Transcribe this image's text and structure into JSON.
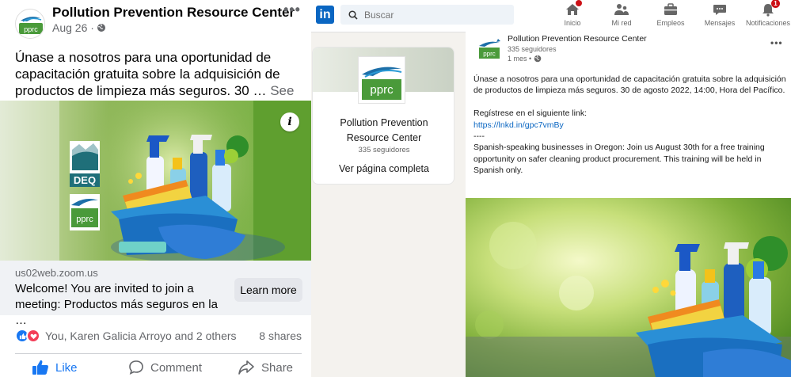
{
  "facebook": {
    "page_name": "Pollution Prevention Resource Center",
    "date": "Aug 26 · ",
    "more": "•••",
    "post_text": "Únase a nosotros para una oportunidad de capacitación gratuita sobre la adquisición de productos de limpieza más seguros. 30 … ",
    "see_more": "See more",
    "info_glyph": "i",
    "logo_text": "pprc",
    "deq_text": "DEQ",
    "link": {
      "domain": "us02web.zoom.us",
      "title": "Welcome! You are invited to join a meeting: Productos más seguros en la …",
      "button": "Learn more"
    },
    "reactions_text": "You, Karen Galicia Arroyo and 2 others",
    "shares": "8 shares",
    "actions": {
      "like": "Like",
      "comment": "Comment",
      "share": "Share"
    }
  },
  "linkedin": {
    "logo": "in",
    "search_placeholder": "Buscar",
    "nav": [
      {
        "label": "Inicio",
        "icon": "home-icon"
      },
      {
        "label": "Mi red",
        "icon": "network-icon"
      },
      {
        "label": "Empleos",
        "icon": "briefcase-icon"
      },
      {
        "label": "Mensajes",
        "icon": "messaging-icon"
      },
      {
        "label": "Notificaciones",
        "icon": "bell-icon",
        "badge": "1"
      }
    ],
    "company": {
      "logo_text": "pprc",
      "name_line1": "Pollution Prevention",
      "name_line2": "Resource Center",
      "followers": "335 seguidores",
      "view_page": "Ver página completa"
    },
    "post": {
      "author": "Pollution Prevention Resource Center",
      "followers": "335 seguidores",
      "time": "1 mes • ",
      "more": "•••",
      "para1": "Únase a nosotros para una oportunidad de capacitación gratuita sobre la adquisición de productos de limpieza más seguros. 30 de agosto 2022, 14:00, Hora del Pacífico.",
      "register": "Regístrese en el siguiente link:",
      "link": "https://lnkd.in/gpc7vmBy",
      "dashes": "----",
      "para2": "Spanish-speaking businesses in Oregon: Join us August 30th for a free training opportunity on safer cleaning product procurement. This training will be held in Spanish only."
    }
  },
  "colors": {
    "facebook_blue": "#1877f2",
    "linkedin_blue": "#0a66c2",
    "pprc_green": "#4a9a3a",
    "deq_teal": "#1f6f79",
    "notification_red": "#cc1016"
  }
}
